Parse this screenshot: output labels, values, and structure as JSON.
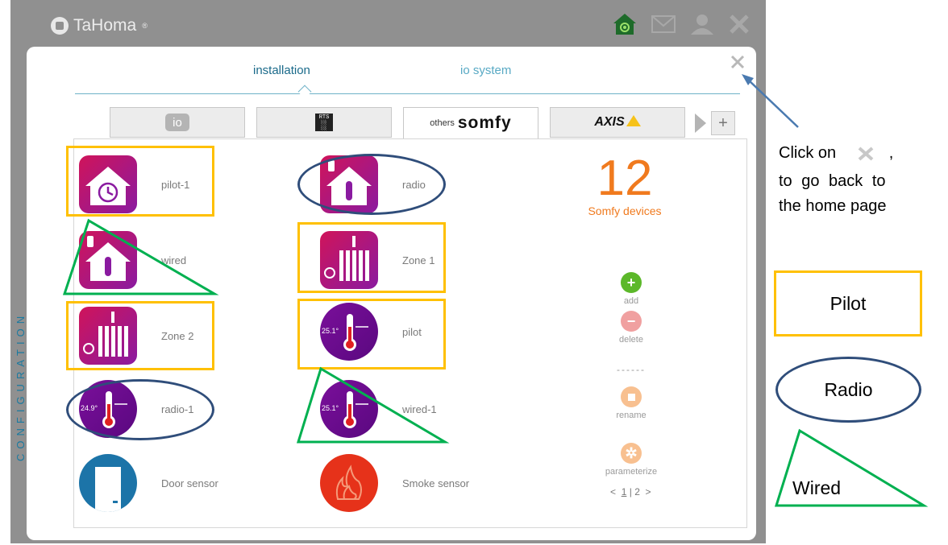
{
  "app": {
    "brand": "TaHoma",
    "brand_mark": "®"
  },
  "top_tabs": {
    "installation": "installation",
    "io_system": "io system"
  },
  "brand_tabs": {
    "io": "io",
    "rts_line1": "RTS",
    "rts_line2": "░",
    "others": "others",
    "somfy": "somfy",
    "axis": "AXIS",
    "add": "+"
  },
  "devices": [
    {
      "name": "pilot-1",
      "icon": "house-clock-icon"
    },
    {
      "name": "radio",
      "icon": "house-thermometer-icon"
    },
    {
      "name": "wired",
      "icon": "house-thermometer-icon"
    },
    {
      "name": "Zone 1",
      "icon": "radiator-icon"
    },
    {
      "name": "Zone 2",
      "icon": "radiator-icon"
    },
    {
      "name": "pilot",
      "icon": "thermometer-icon",
      "temp": "25.1°"
    },
    {
      "name": "radio-1",
      "icon": "thermometer-icon",
      "temp": "24.9°"
    },
    {
      "name": "wired-1",
      "icon": "thermometer-icon",
      "temp": "25.1°"
    },
    {
      "name": "Door sensor",
      "icon": "door-sensor-icon"
    },
    {
      "name": "Smoke sensor",
      "icon": "smoke-sensor-icon"
    }
  ],
  "counter": {
    "value": "12",
    "label": "Somfy devices"
  },
  "actions": {
    "add": "add",
    "delete": "delete",
    "separator": "------",
    "rename": "rename",
    "parameterize": "parameterize"
  },
  "pager": {
    "prev": "<",
    "page1": "1",
    "sep": "|",
    "page2": "2",
    "next": ">"
  },
  "side_label": "CONFIGURATION",
  "annotation": {
    "line1_a": "Click on",
    "line1_b": ",",
    "line2": "to go back to",
    "line3": "the home page"
  },
  "legend": {
    "pilot": "Pilot",
    "radio": "Radio",
    "wired": "Wired"
  },
  "colors": {
    "pilot": "#ffc000",
    "radio": "#2f4d7a",
    "wired": "#00b050",
    "accent_orange": "#f07a1e",
    "add_green": "#5cb82a",
    "delete_red": "#e85a5a"
  }
}
